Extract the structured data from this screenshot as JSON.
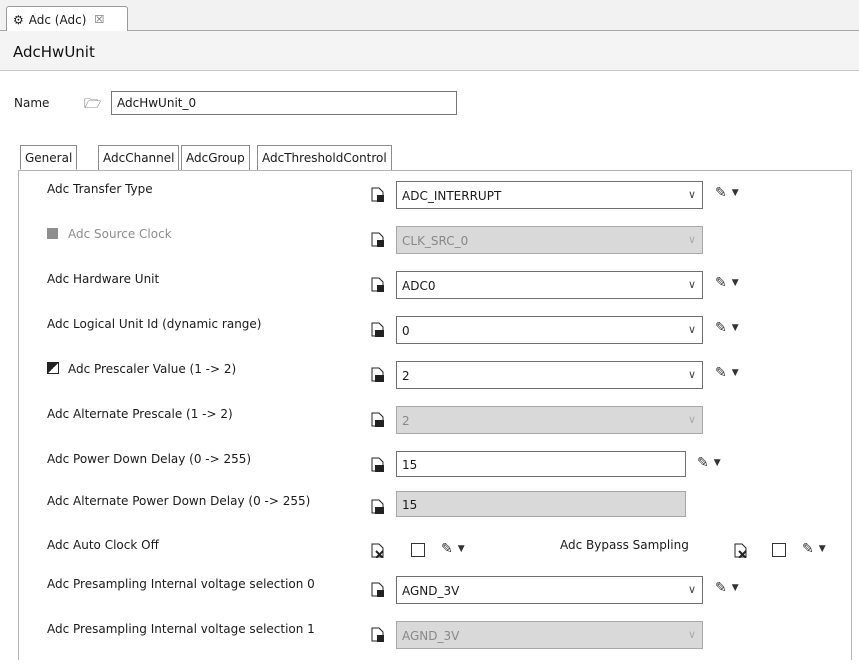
{
  "editor_tab": {
    "title": "Adc (Adc)",
    "close": "☒"
  },
  "header": {
    "title": "AdcHwUnit"
  },
  "name_field": {
    "label": "Name",
    "value": "AdcHwUnit_0"
  },
  "subtabs": [
    {
      "label": "General"
    },
    {
      "label": "AdcChannel"
    },
    {
      "label": "AdcGroup"
    },
    {
      "label": "AdcThresholdControl"
    }
  ],
  "rows": {
    "transfer_type": {
      "label": "Adc Transfer Type",
      "value": "ADC_INTERRUPT"
    },
    "source_clock": {
      "label": "Adc Source Clock",
      "value": "CLK_SRC_0"
    },
    "hardware_unit": {
      "label": "Adc Hardware Unit",
      "value": "ADC0"
    },
    "logical_unit_id": {
      "label": "Adc Logical Unit Id (dynamic range)",
      "value": "0"
    },
    "prescaler_value": {
      "label": "Adc Prescaler Value (1 -> 2)",
      "value": "2"
    },
    "alternate_prescale": {
      "label": "Adc Alternate Prescale (1 -> 2)",
      "value": "2"
    },
    "power_down_delay": {
      "label": "Adc Power Down Delay (0 -> 255)",
      "value": "15"
    },
    "alt_power_down_delay": {
      "label": "Adc Alternate Power Down Delay (0 -> 255)",
      "value": "15"
    },
    "auto_clock_off": {
      "label": "Adc Auto Clock Off",
      "checked": false
    },
    "bypass_sampling": {
      "label": "Adc Bypass Sampling",
      "checked": false
    },
    "presampling_0": {
      "label": "Adc Presampling Internal voltage selection 0",
      "value": "AGND_3V"
    },
    "presampling_1": {
      "label": "Adc Presampling Internal voltage selection 1",
      "value": "AGND_3V"
    }
  },
  "icons": {
    "dropdown": "∨",
    "menu_arrow": "▼",
    "pencil": "✎",
    "folder": "🗁"
  }
}
